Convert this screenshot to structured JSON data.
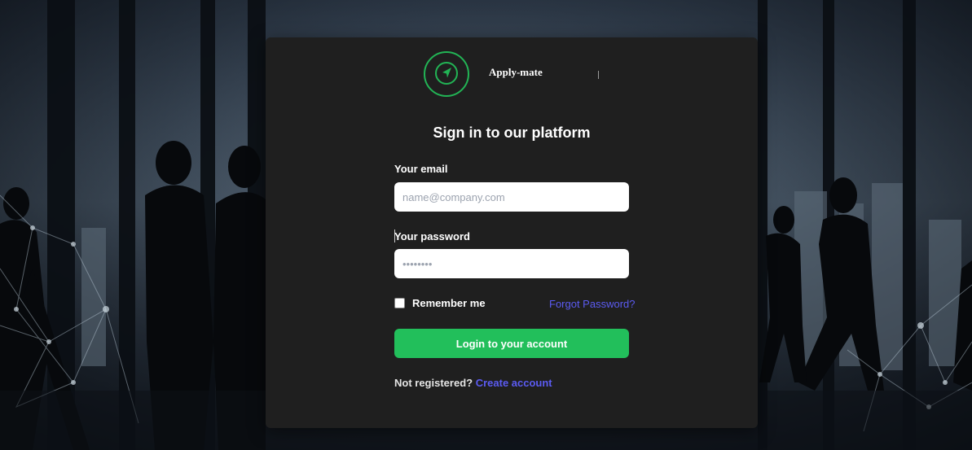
{
  "brand": {
    "name": "Apply-mate",
    "logo_icon": "navigation-arrow-icon",
    "accent_color": "#22b455"
  },
  "login": {
    "title": "Sign in to our platform",
    "email_label": "Your email",
    "email_placeholder": "name@company.com",
    "email_value": "",
    "password_label": "Your password",
    "password_placeholder": "••••••••",
    "password_value": "",
    "remember_label": "Remember me",
    "remember_checked": false,
    "forgot_label": "Forgot Password?",
    "submit_label": "Login to your account",
    "register_prompt": "Not registered?",
    "register_link": "Create account"
  },
  "colors": {
    "card_bg": "#1f1f1f",
    "button_bg": "#22bf5b",
    "link": "#5b5bf2"
  }
}
